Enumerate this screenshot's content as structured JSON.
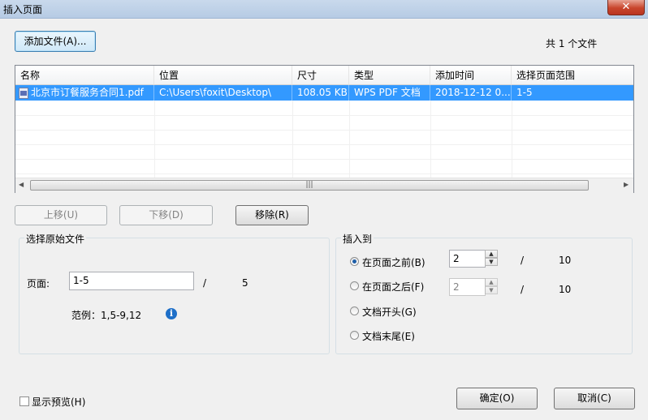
{
  "window": {
    "title": "插入页面",
    "close_label": "✕"
  },
  "add_file_button": "添加文件(A)...",
  "file_count": "共 1 个文件",
  "table": {
    "columns": [
      "名称",
      "位置",
      "尺寸",
      "类型",
      "添加时间",
      "选择页面范围"
    ],
    "rows": [
      [
        "北京市订餐服务合同1.pdf",
        "C:\\Users\\foxit\\Desktop\\",
        "108.05 KB",
        "WPS PDF 文档",
        "2018-12-12 0...",
        "1-5"
      ]
    ]
  },
  "buttons": {
    "move_up": "上移(U)",
    "move_down": "下移(D)",
    "remove": "移除(R)",
    "ok": "确定(O)",
    "cancel": "取消(C)"
  },
  "source": {
    "group_title": "选择原始文件",
    "pages_label": "页面:",
    "pages_value": "1-5",
    "slash": "/",
    "total_pages": "5",
    "example": "范例：1,5-9,12"
  },
  "insert": {
    "group_title": "插入到",
    "before_label": "在页面之前(B)",
    "before_value": "2",
    "after_label": "在页面之后(F)",
    "after_value": "2",
    "slash": "/",
    "total_pages": "10",
    "start_label": "文档开头(G)",
    "end_label": "文档末尾(E)",
    "selected": "before"
  },
  "show_preview": "显示预览(H)"
}
